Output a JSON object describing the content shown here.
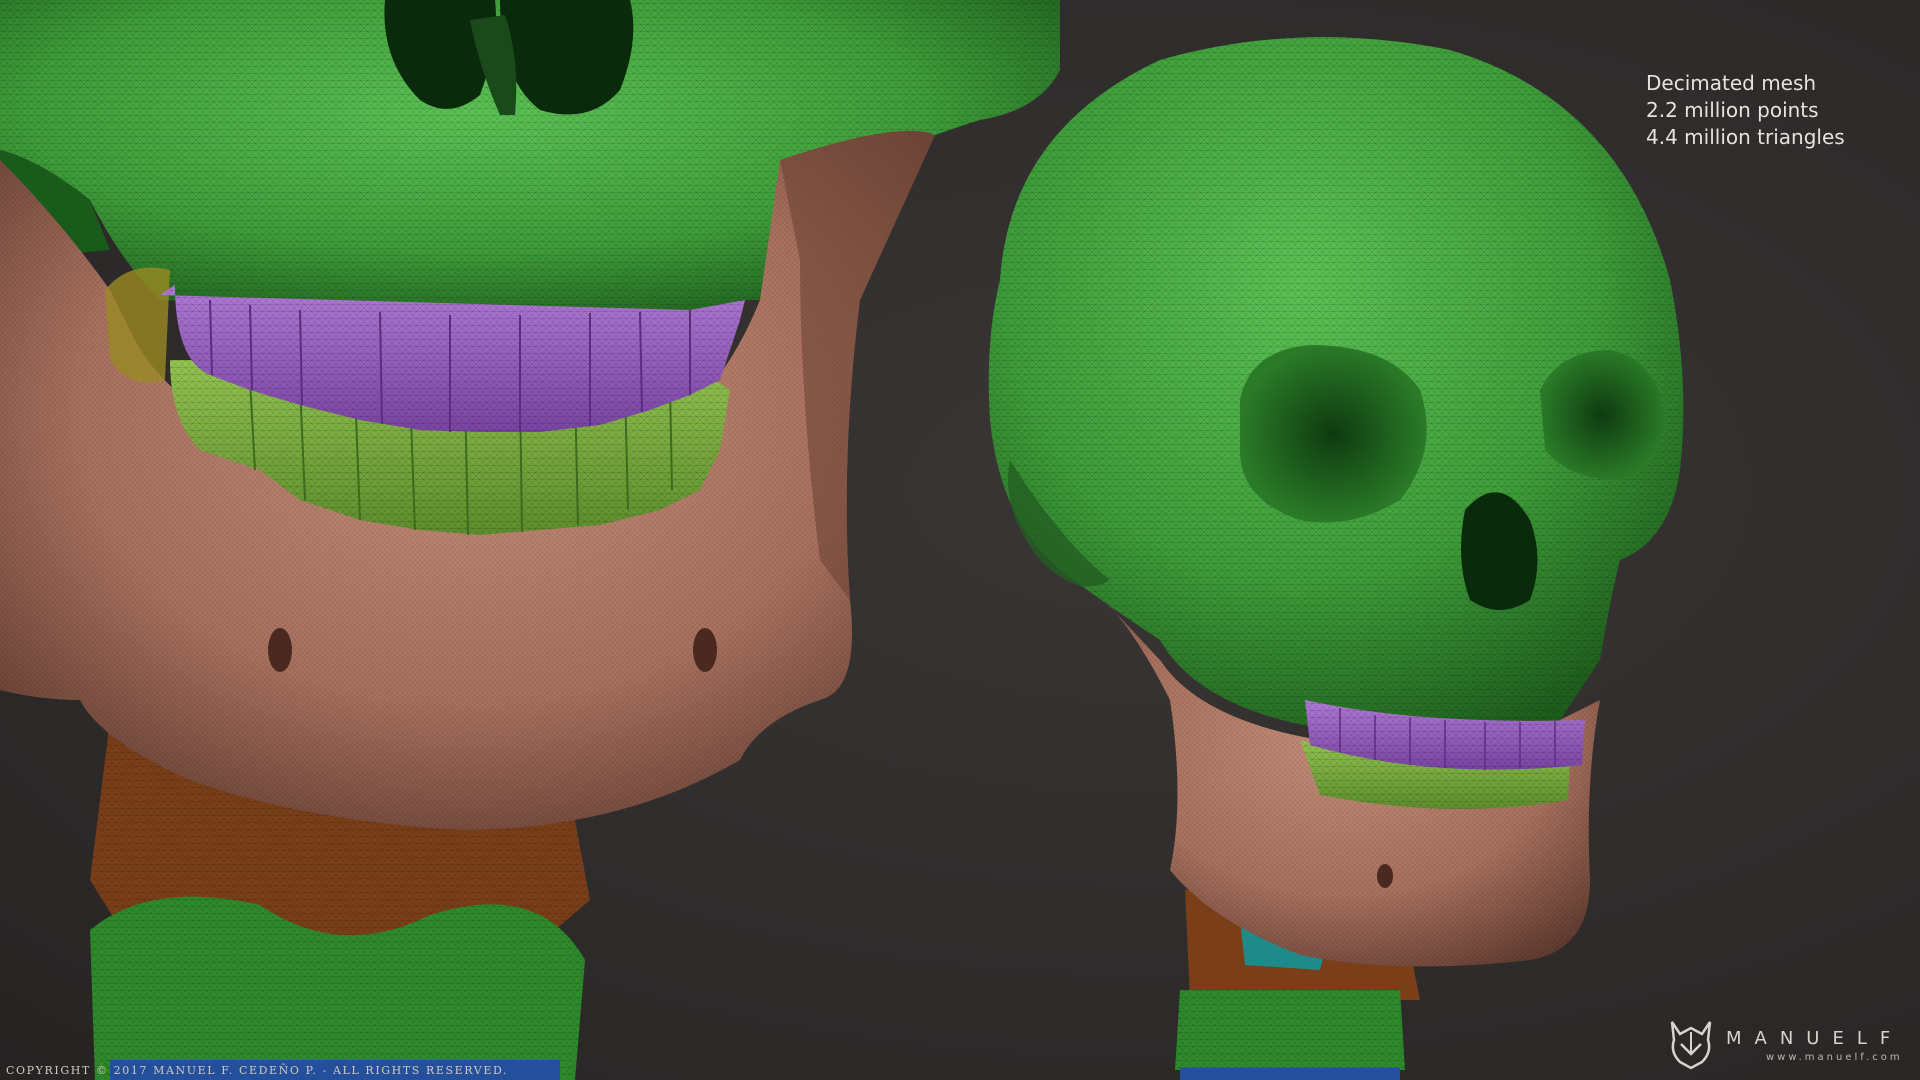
{
  "info": {
    "line1": "Decimated mesh",
    "line2": "2.2 million points",
    "line3": "4.4 million triangles"
  },
  "copyright": "COPYRIGHT © 2017 MANUEL F. CEDEÑO P. - ALL RIGHTS RESERVED.",
  "brand": {
    "name": "MANUELF",
    "url": "www.manuelf.com"
  },
  "colors": {
    "background": "#2e2b2b",
    "cranium": "#3f9e3a",
    "mandible": "#a8705e",
    "upper_teeth": "#9a5fc0",
    "lower_teeth": "#7aae3e",
    "vertebra_orange": "#8a4a1e",
    "vertebra_green": "#2f8a2c",
    "vertebra_cyan": "#1f8a8a"
  }
}
